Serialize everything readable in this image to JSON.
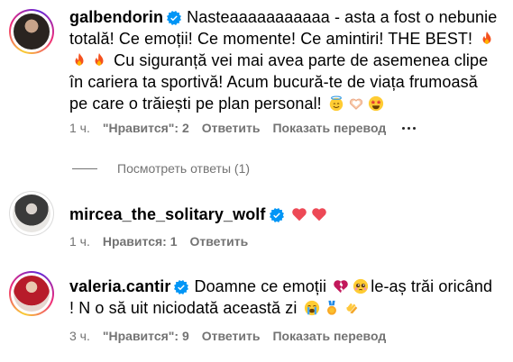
{
  "comments": [
    {
      "username": "galbendorin",
      "text_a": "Nasteaaaaaaaaaaa - asta a fost o nebunie totală! Ce emoții! Ce momente! Ce amintiri! THE BEST!",
      "text_b": "Cu siguranță vei mai avea parte de asemenea clipe în cariera ta sportivă! Acum bucură-te de viața frumoasă pe care o trăiești pe plan personal!",
      "time": "1 ч.",
      "likes": "\"Нравится\": 2",
      "reply": "Ответить",
      "translate": "Показать перевод"
    },
    {
      "username": "mircea_the_solitary_wolf",
      "text_a": "",
      "time": "1 ч.",
      "likes": "Нравится: 1",
      "reply": "Ответить"
    },
    {
      "username": "valeria.cantir",
      "text_a": "Doamne ce emoții",
      "text_b": "le-aș trăi oricând ! N o să uit niciodată această zi",
      "time": "3 ч.",
      "likes": "\"Нравится\": 9",
      "reply": "Ответить",
      "translate": "Показать перевод"
    }
  ],
  "view_replies": "Посмотреть ответы (1)",
  "colors": {
    "verified": "#0095f6",
    "meta_text": "#737373",
    "heart": "#ed4956"
  },
  "icons": [
    "verified-badge-icon",
    "fire-emoji-icon",
    "angel-emoji-icon",
    "heart-hands-emoji-icon",
    "star-struck-emoji-icon",
    "red-heart-emoji-icon",
    "broken-heart-emoji-icon",
    "pleading-face-emoji-icon",
    "crying-face-emoji-icon",
    "medal-emoji-icon",
    "clapping-emoji-icon",
    "more-options-icon"
  ]
}
